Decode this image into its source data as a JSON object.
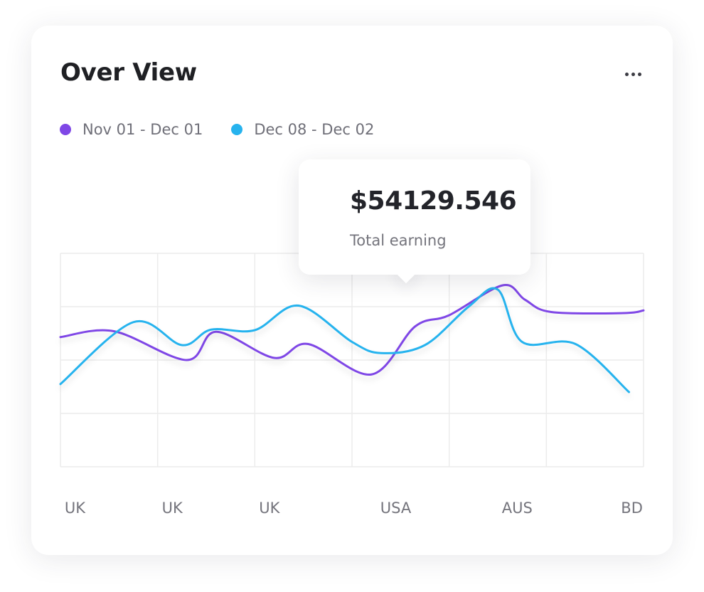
{
  "card": {
    "title": "Over View",
    "more_icon": "more-horizontal-icon"
  },
  "tooltip": {
    "value": "$54129.546",
    "label": "Total earning"
  },
  "colors": {
    "series_1": "#7f47e6",
    "series_2": "#27b3ee",
    "grid": "#ececec"
  },
  "chart_data": {
    "type": "line",
    "title": "Over View",
    "xlabel": "",
    "ylabel": "",
    "categories": [
      "UK",
      "UK",
      "UK",
      "USA",
      "AUS",
      "BD"
    ],
    "grid": true,
    "legend_position": "top-left",
    "smooth": true,
    "ylim": [
      0,
      4
    ],
    "series": [
      {
        "name": "Nov 01 - Dec 01",
        "color": "#7f47e6",
        "x": [
          0,
          0.55,
          1.3,
          1.6,
          2.2,
          2.55,
          3.2,
          3.65,
          4.0,
          4.55,
          4.78,
          5.05,
          5.8,
          6.0
        ],
        "y": [
          2.43,
          2.54,
          2.0,
          2.53,
          2.04,
          2.3,
          1.73,
          2.63,
          2.84,
          3.4,
          3.13,
          2.9,
          2.88,
          2.93
        ]
      },
      {
        "name": "Dec 08 - Dec 02",
        "color": "#27b3ee",
        "x": [
          0,
          0.75,
          1.25,
          1.55,
          2.0,
          2.45,
          3.0,
          3.3,
          3.75,
          4.2,
          4.5,
          4.75,
          5.3,
          5.85
        ],
        "y": [
          1.55,
          2.71,
          2.28,
          2.57,
          2.56,
          3.02,
          2.34,
          2.13,
          2.28,
          3.0,
          3.32,
          2.34,
          2.3,
          1.4
        ]
      }
    ]
  }
}
